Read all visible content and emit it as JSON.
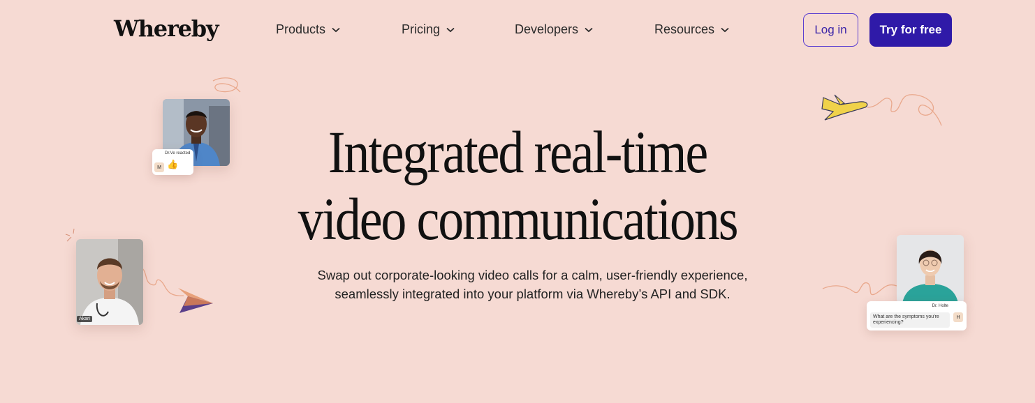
{
  "brand": {
    "logo_text": "Whereby"
  },
  "nav": {
    "items": [
      {
        "label": "Products"
      },
      {
        "label": "Pricing"
      },
      {
        "label": "Developers"
      },
      {
        "label": "Resources"
      }
    ],
    "login_label": "Log in",
    "try_label": "Try for free"
  },
  "hero": {
    "title_line1": "Integrated real-time",
    "title_line2": "video communications",
    "subtitle_line1": "Swap out corporate-looking video calls for a calm, user-friendly experience,",
    "subtitle_line2": "seamlessly integrated into your platform via Whereby’s API and SDK."
  },
  "decor": {
    "top_card_text": "Dr.Ve reacted",
    "top_card_badge": "M",
    "reaction_emoji": "👍",
    "left_name_tag": "Akari",
    "right_card_name": "Dr. Holte",
    "right_card_message": "What are the symptoms you're experiencing?",
    "right_card_badge": "H"
  },
  "colors": {
    "background": "#f6dad3",
    "accent": "#2f1aa8",
    "login_border": "#5b3fd1"
  }
}
